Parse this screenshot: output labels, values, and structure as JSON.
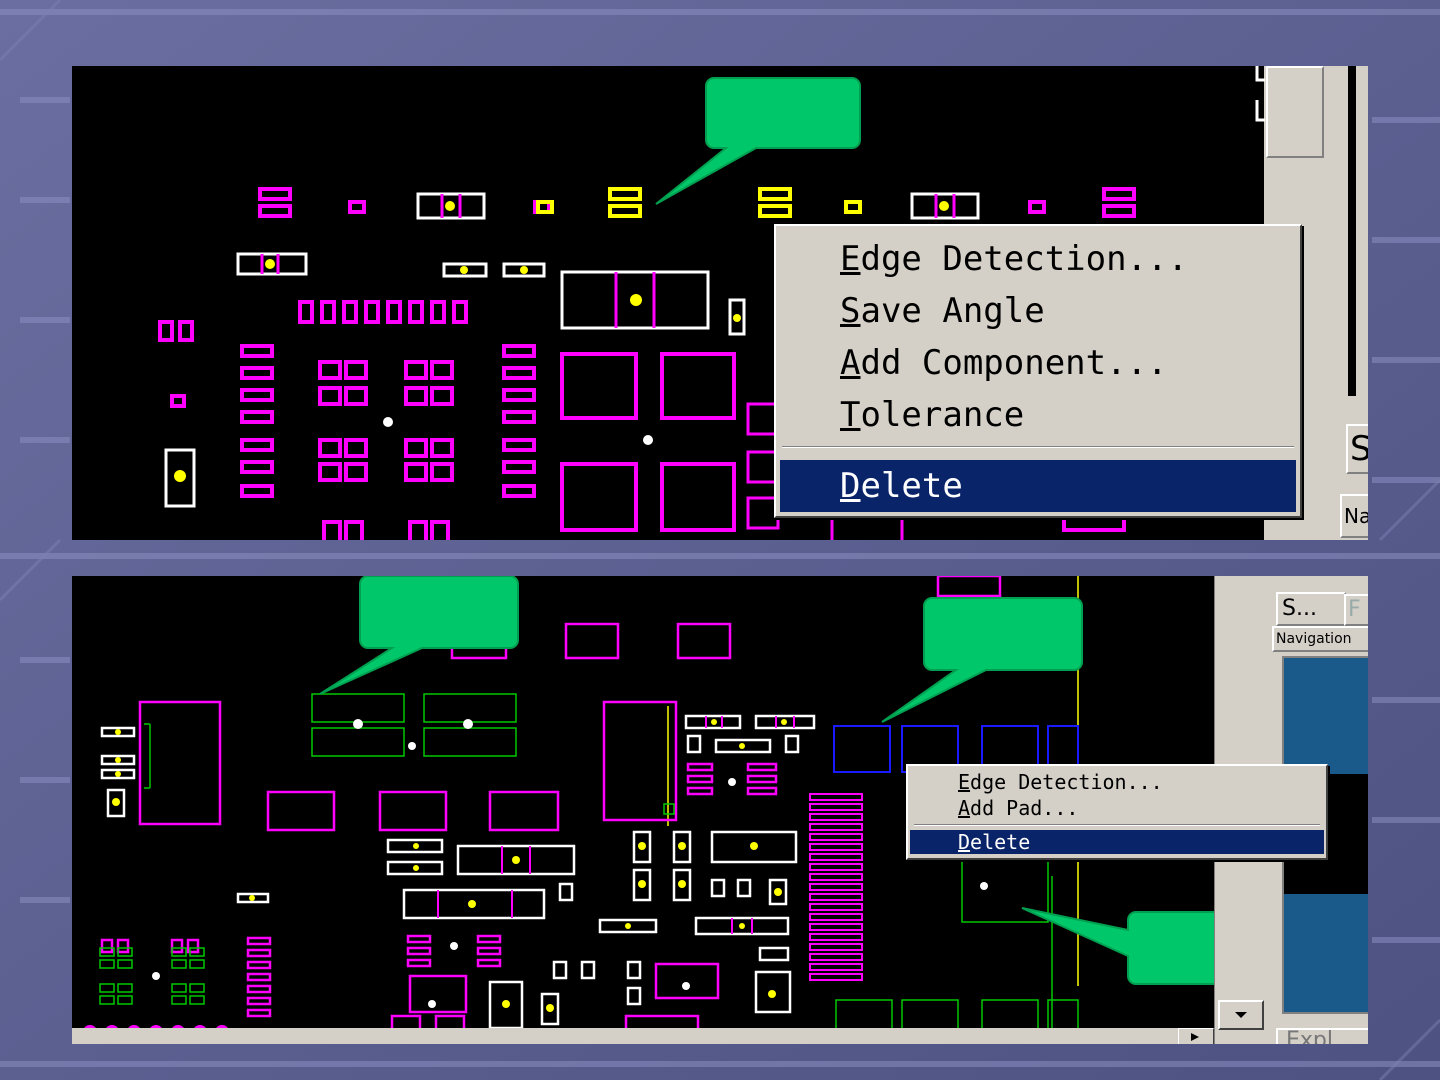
{
  "colors": {
    "background": "#5a5e8c",
    "canvas": "#000000",
    "callout": "#00c86a",
    "magenta": "#ff00ff",
    "yellow": "#ffff00",
    "green": "#00c800",
    "blue": "#1a1aff",
    "highlight": "#0a246a",
    "panel_gray": "#d4d0c8"
  },
  "top_panel": {
    "context_menu": {
      "items": [
        {
          "label": "Edge Detection...",
          "mnemonic": "E"
        },
        {
          "label": "Save Angle",
          "mnemonic": "S"
        },
        {
          "label": "Add Component...",
          "mnemonic": "A"
        },
        {
          "label": "Tolerance",
          "mnemonic": "T"
        }
      ],
      "selected_item": {
        "label": "Delete",
        "mnemonic": "D"
      }
    },
    "side_tab_label": "S",
    "side_tab_label2": "Na"
  },
  "bottom_panel": {
    "context_menu": {
      "items": [
        {
          "label": "Edge Detection...",
          "mnemonic": "E"
        },
        {
          "label": "Add Pad...",
          "mnemonic": "A"
        }
      ],
      "selected_item": {
        "label": "Delete",
        "mnemonic": "D"
      }
    },
    "side_tabs": {
      "tab1": "S...",
      "tab2": "F",
      "navigation": "Navigation"
    },
    "explorer_label": "Expl"
  },
  "icons": [
    "scroll-right-arrow-icon",
    "scroll-down-arrow-icon"
  ]
}
